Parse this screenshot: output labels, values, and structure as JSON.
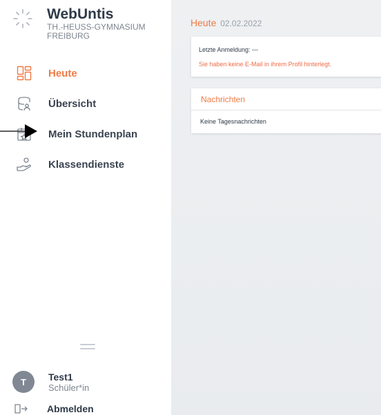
{
  "brand": {
    "name": "WebUntis",
    "school_line1": "TH.-HEUSS-GYMNASIUM",
    "school_line2": "FREIBURG"
  },
  "nav": {
    "items": [
      {
        "label": "Heute",
        "icon": "dashboard-grid-icon",
        "active": true
      },
      {
        "label": "Übersicht",
        "icon": "overview-stack-icon",
        "active": false
      },
      {
        "label": "Mein Stundenplan",
        "icon": "timetable-calendar-icon",
        "active": false
      },
      {
        "label": "Klassendienste",
        "icon": "class-duty-icon",
        "active": false
      }
    ]
  },
  "user": {
    "initial": "T",
    "name": "Test1",
    "role": "Schüler*in"
  },
  "logout": {
    "label": "Abmelden",
    "icon": "logout-icon"
  },
  "main": {
    "title": "Heute",
    "date": "02.02.2022",
    "login_card": {
      "last_login": "Letzte Anmeldung: ---",
      "email_warning": "Sie haben keine E-Mail in ihrem Profil hinterlegt."
    },
    "news_card": {
      "title": "Nachrichten",
      "empty_text": "Keine Tagesnachrichten"
    }
  },
  "colors": {
    "accent": "#ef7b45",
    "text_dark": "#2f3a48",
    "text_muted": "#7d858f",
    "main_bg": "#eef0f2"
  }
}
